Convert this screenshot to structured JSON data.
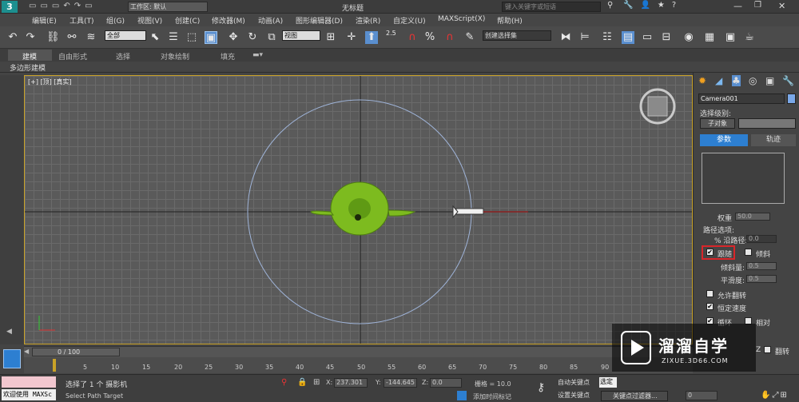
{
  "titlebar": {
    "workspace_label": "工作区: 默认",
    "title": "无标题",
    "search_placeholder": "键入关键字或短语"
  },
  "menu": [
    "编辑(E)",
    "工具(T)",
    "组(G)",
    "视图(V)",
    "创建(C)",
    "修改器(M)",
    "动画(A)",
    "图形编辑器(D)",
    "渲染(R)",
    "自定义(U)",
    "MAXScript(X)",
    "帮助(H)"
  ],
  "toolbar": {
    "filter_value": "全部",
    "coord_value": "视图",
    "selection_set_value": "创建选择集",
    "snap_angle": "2.5"
  },
  "ribbon": {
    "tabs": [
      "建模",
      "自由形式",
      "选择",
      "对象绘制",
      "填充"
    ],
    "sub_label": "多边形建模"
  },
  "viewport": {
    "label": "[+] [顶] [真实]"
  },
  "cmdpanel": {
    "object_name": "Camera001",
    "selection_level_label": "选择级别:",
    "subobject_button": "子对象",
    "tab_params": "参数",
    "tab_track": "轨迹",
    "weight_label": "权重",
    "weight_value": "50.0",
    "path_options_label": "路径选项:",
    "along_path_label": "% 沿路径:",
    "along_path_value": "0.0",
    "follow_label": "跟随",
    "follow_checked": true,
    "bank_label": "倾斜",
    "bank_amount_label": "倾斜量:",
    "bank_amount_value": "0.5",
    "smooth_label": "平滑度:",
    "smooth_value": "0.5",
    "allow_flip_label": "允许翻转",
    "constant_velocity_label": "恒定速度",
    "loop_label": "循环",
    "relative_label": "相对",
    "flip_label": "翻转",
    "z_label": "Z"
  },
  "timeline": {
    "frame_label": "0 / 100",
    "ticks": [
      "5",
      "10",
      "15",
      "20",
      "25",
      "30",
      "35",
      "40",
      "45",
      "50",
      "55",
      "60",
      "65",
      "70",
      "75",
      "80",
      "85",
      "90"
    ]
  },
  "status": {
    "welcome": "欢迎使用 MAXSc",
    "selected_text": "选择了 1 个 摄影机",
    "prompt_text": "Select Path Target",
    "x_label": "X:",
    "x_value": "237.301",
    "y_label": "Y:",
    "y_value": "-144.645",
    "z_label": "Z:",
    "z_value": "0.0",
    "grid_text": "栅格 = 10.0",
    "auto_key": "自动关键点",
    "set_key": "设置关键点",
    "selected_obj": "选定",
    "add_time_tag": "添加时间标记",
    "key_filter": "关键点过滤器...",
    "frame_value": "0"
  },
  "watermark": {
    "brand": "溜溜自学",
    "url": "ZIXUE.3D66.COM"
  },
  "colors": {
    "viewport_border": "#c9a227",
    "teapot": "#7dbb1f",
    "active_tab": "#2d7fd1",
    "highlight_box": "#d9262a",
    "circle": "#9fb4d9"
  }
}
